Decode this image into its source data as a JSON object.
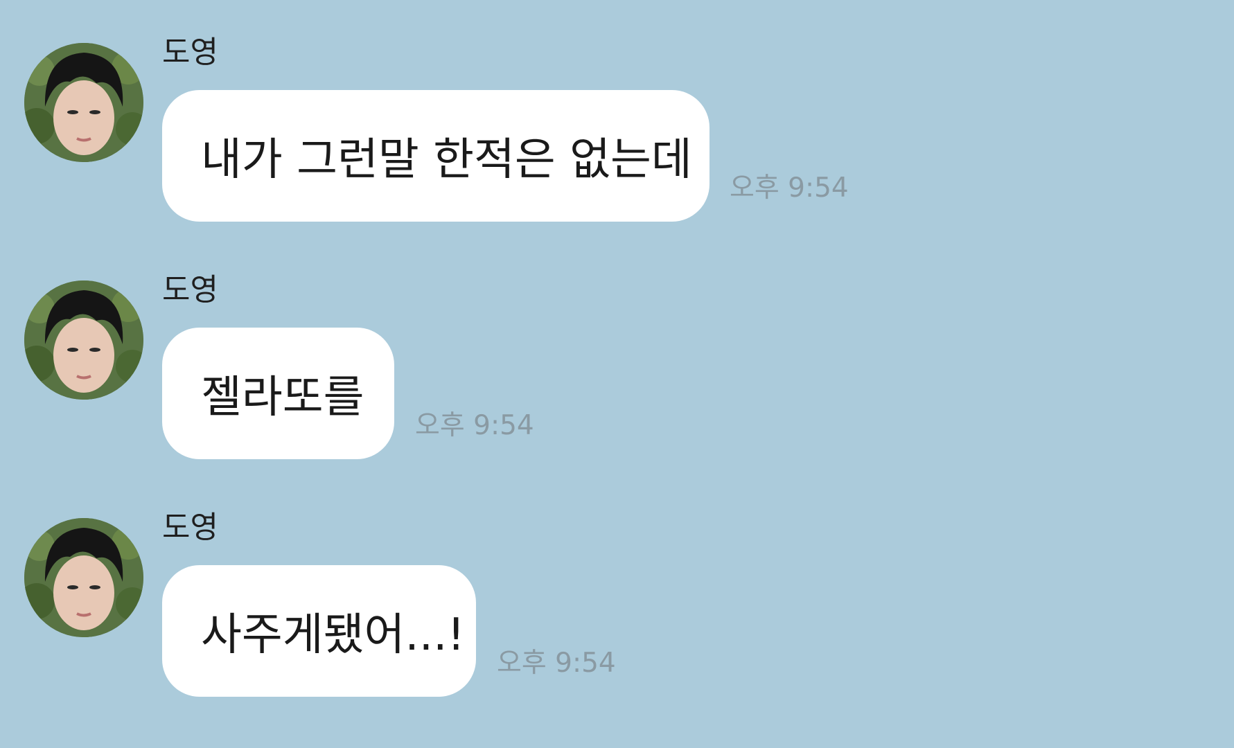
{
  "colors": {
    "background": "#abcbdb",
    "bubble": "#ffffff",
    "time_text": "#8a9aa3",
    "name_text": "#1f1f1f"
  },
  "messages": [
    {
      "sender": "도영",
      "text": "내가 그런말 한적은 없는데",
      "time": "오후 9:54",
      "avatar": "profile-photo"
    },
    {
      "sender": "도영",
      "text": "젤라또를",
      "time": "오후 9:54",
      "avatar": "profile-photo"
    },
    {
      "sender": "도영",
      "text": "사주게됐어...!",
      "time": "오후 9:54",
      "avatar": "profile-photo"
    }
  ]
}
